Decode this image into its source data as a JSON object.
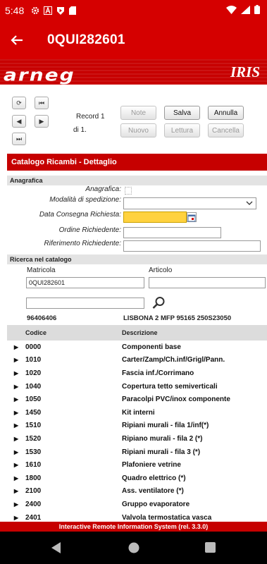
{
  "status": {
    "time": "5:48"
  },
  "appbar": {
    "title": "0QUI282601"
  },
  "banner": {
    "logo": "arneg",
    "product": "IRIS"
  },
  "record": {
    "line1": "Record 1",
    "line2": "di 1."
  },
  "actions": {
    "note": "Note",
    "salva": "Salva",
    "annulla": "Annulla",
    "nuovo": "Nuovo",
    "lettura": "Lettura",
    "cancella": "Cancella"
  },
  "panel_title": "Catalogo Ricambi - Dettaglio",
  "anagrafica": {
    "section": "Anagrafica",
    "anagrafica_label": "Anagrafica:",
    "modalita_label": "Modalità di spedizione:",
    "data_label": "Data Consegna Richiesta:",
    "ordine_label": "Ordine Richiedente:",
    "riferimento_label": "Riferimento Richiedente:"
  },
  "ricerca": {
    "section": "Ricerca nel catalogo",
    "matricola_label": "Matricola",
    "articolo_label": "Articolo",
    "matricola_value": "0QUI282601",
    "code": "96406406",
    "desc": "LISBONA 2 MFP 95165 250S23050"
  },
  "table": {
    "headers": {
      "code": "Codice",
      "desc": "Descrizione"
    },
    "rows": [
      {
        "code": "0000",
        "desc": "Componenti base"
      },
      {
        "code": "1010",
        "desc": "Carter/Zamp/Ch.inf/Grigl/Pann."
      },
      {
        "code": "1020",
        "desc": "Fascia inf./Corrimano"
      },
      {
        "code": "1040",
        "desc": "Copertura tetto semiverticali"
      },
      {
        "code": "1050",
        "desc": "Paracolpi PVC/inox componente"
      },
      {
        "code": "1450",
        "desc": "Kit interni"
      },
      {
        "code": "1510",
        "desc": "Ripiani murali - fila 1/inf(*)"
      },
      {
        "code": "1520",
        "desc": "Ripiano murali - fila 2 (*)"
      },
      {
        "code": "1530",
        "desc": "Ripiani murali - fila 3 (*)"
      },
      {
        "code": "1610",
        "desc": "Plafoniere vetrine"
      },
      {
        "code": "1800",
        "desc": "Quadro elettrico (*)"
      },
      {
        "code": "2100",
        "desc": "Ass. ventilatore (*)"
      },
      {
        "code": "2400",
        "desc": "Gruppo evaporatore"
      },
      {
        "code": "2401",
        "desc": "Valvola termostatica vasca"
      }
    ]
  },
  "footer": "Interactive Remote Information System (rel. 3.3.0)",
  "colors": {
    "brand_red": "#d50000",
    "date_field": "#ffd23f"
  }
}
